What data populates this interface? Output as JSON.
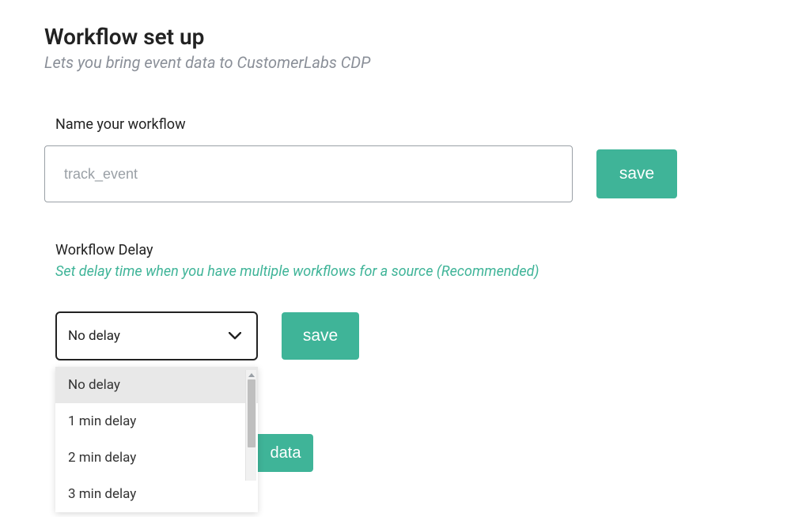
{
  "header": {
    "title": "Workflow set up",
    "subtitle": "Lets you bring event data to CustomerLabs CDP"
  },
  "name_section": {
    "label": "Name your workflow",
    "placeholder": "track_event",
    "value": "",
    "save_label": "save"
  },
  "delay_section": {
    "label": "Workflow Delay",
    "help_text": "Set delay time when you have multiple workflows for a source (Recommended)",
    "selected": "No delay",
    "save_label": "save",
    "options": [
      "No delay",
      "1 min delay",
      "2 min delay",
      "3 min delay"
    ]
  },
  "partial_button": {
    "visible_text": "data"
  },
  "colors": {
    "accent": "#3fb498",
    "text": "#222222",
    "muted": "#8a8f98"
  }
}
